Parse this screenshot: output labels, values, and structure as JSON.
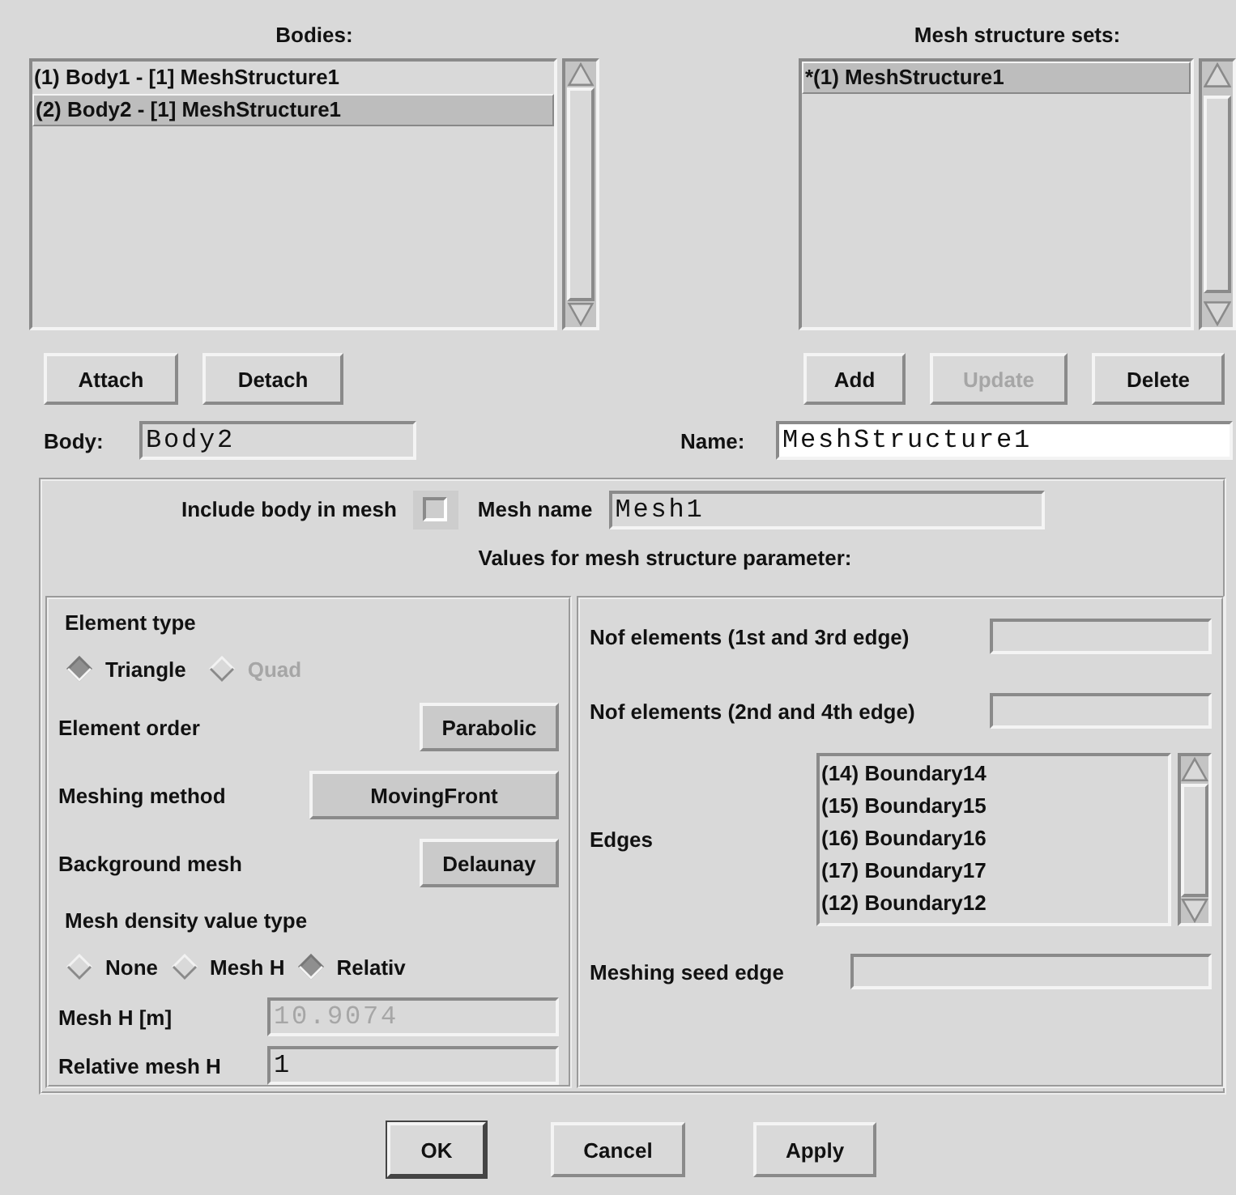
{
  "bodies": {
    "title": "Bodies:",
    "items": [
      {
        "label": "(1) Body1 - [1] MeshStructure1",
        "selected": false
      },
      {
        "label": "(2) Body2 - [1] MeshStructure1",
        "selected": true
      }
    ],
    "buttons": [
      {
        "label": "Attach",
        "disabled": false
      },
      {
        "label": "Detach",
        "disabled": false
      }
    ]
  },
  "mesh_sets": {
    "title": "Mesh structure sets:",
    "items": [
      {
        "label": "*(1) MeshStructure1",
        "selected": true
      }
    ],
    "buttons": [
      {
        "label": "Add",
        "disabled": false
      },
      {
        "label": "Update",
        "disabled": true
      },
      {
        "label": "Delete",
        "disabled": false
      }
    ]
  },
  "body_field": {
    "label": "Body:",
    "value": "Body2",
    "editable": false
  },
  "name_field": {
    "label": "Name:",
    "value": "MeshStructure1",
    "editable": true
  },
  "include": {
    "label": "Include body in mesh",
    "checked": false
  },
  "mesh_name": {
    "label": "Mesh name",
    "value": "Mesh1",
    "editable": false
  },
  "section_title": "Values for mesh structure parameter:",
  "element_type": {
    "label": "Element type",
    "options": [
      {
        "label": "Triangle",
        "selected": true,
        "disabled": false
      },
      {
        "label": "Quad",
        "selected": false,
        "disabled": true
      }
    ]
  },
  "option_rows": [
    {
      "label": "Element order",
      "value": "Parabolic",
      "wide": false
    },
    {
      "label": "Meshing method",
      "value": "MovingFront",
      "wide": true
    },
    {
      "label": "Background mesh",
      "value": "Delaunay",
      "wide": false
    }
  ],
  "density": {
    "label": "Mesh density value type",
    "options": [
      {
        "label": "None",
        "selected": false,
        "disabled": false
      },
      {
        "label": "Mesh H",
        "selected": false,
        "disabled": false
      },
      {
        "label": "Relativ",
        "selected": true,
        "disabled": false
      }
    ]
  },
  "mesh_h": {
    "label": "Mesh H [m]",
    "value": "10.9074",
    "disabled": true
  },
  "relative_mesh_h": {
    "label": "Relative mesh H",
    "value": "1",
    "disabled": false
  },
  "nof_first": {
    "label": "Nof elements (1st and 3rd edge)"
  },
  "nof_second": {
    "label": "Nof elements (2nd and 4th edge)"
  },
  "edges": {
    "label": "Edges",
    "items": [
      {
        "label": "(14) Boundary14",
        "selected": false
      },
      {
        "label": "(15) Boundary15",
        "selected": false
      },
      {
        "label": "(16) Boundary16",
        "selected": false
      },
      {
        "label": "(17) Boundary17",
        "selected": false
      },
      {
        "label": "(12) Boundary12",
        "selected": false
      }
    ]
  },
  "seed_edge": {
    "label": "Meshing seed edge"
  },
  "dialog_buttons": [
    {
      "label": "OK",
      "default": true
    },
    {
      "label": "Cancel",
      "default": false
    },
    {
      "label": "Apply",
      "default": false
    }
  ]
}
